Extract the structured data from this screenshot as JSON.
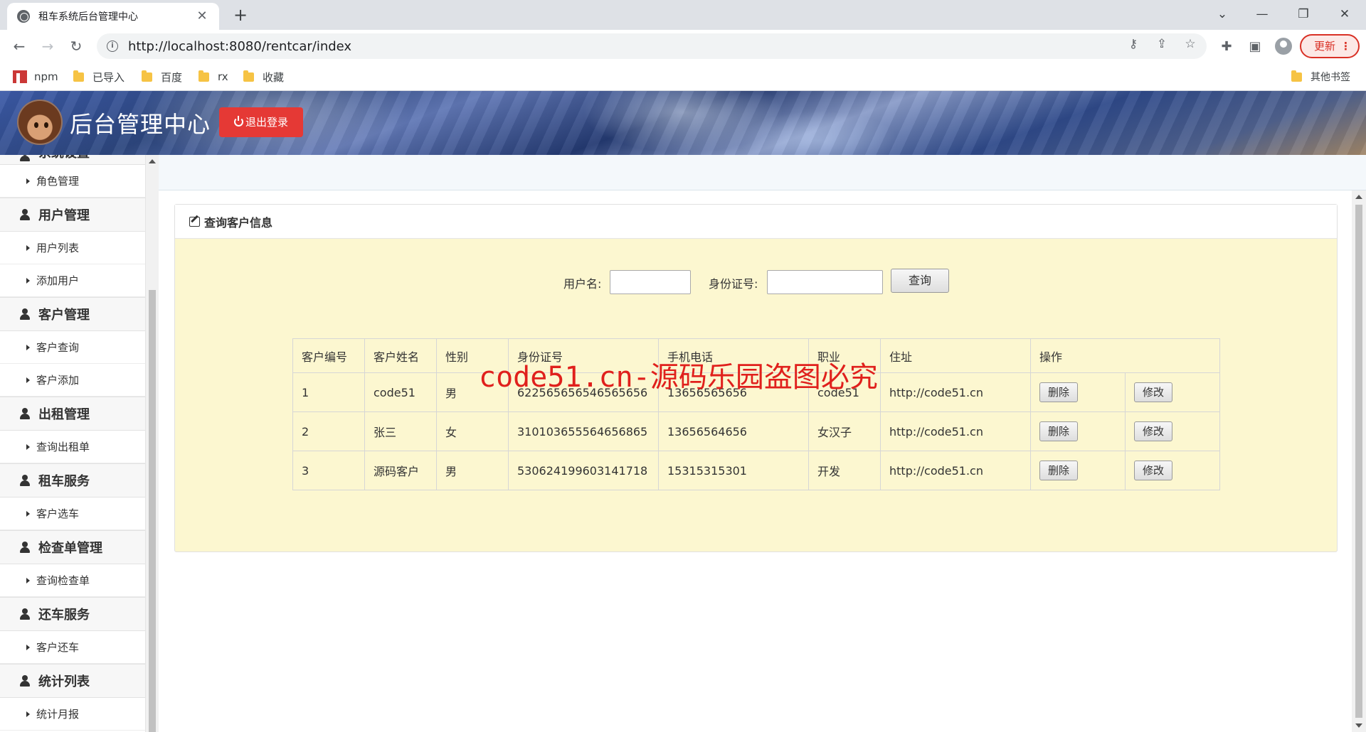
{
  "browser": {
    "tab_title": "租车系统后台管理中心",
    "url": "http://localhost:8080/rentcar/index",
    "update_label": "更新",
    "bookmarks": [
      {
        "label": "npm",
        "icon": "npm-logo-icon"
      },
      {
        "label": "已导入",
        "icon": "folder-icon"
      },
      {
        "label": "百度",
        "icon": "folder-icon"
      },
      {
        "label": "rx",
        "icon": "folder-icon"
      },
      {
        "label": "收藏",
        "icon": "folder-icon"
      }
    ],
    "other_bookmarks": "其他书签"
  },
  "header": {
    "title": "后台管理中心",
    "logout_label": "退出登录",
    "logout_color": "#e53935"
  },
  "sidebar": {
    "partial_group": "系统设置",
    "groups": [
      {
        "label": "系统设置",
        "items": [
          "角色管理"
        ]
      },
      {
        "label": "用户管理",
        "items": [
          "用户列表",
          "添加用户"
        ]
      },
      {
        "label": "客户管理",
        "items": [
          "客户查询",
          "客户添加"
        ]
      },
      {
        "label": "出租管理",
        "items": [
          "查询出租单"
        ]
      },
      {
        "label": "租车服务",
        "items": [
          "客户选车"
        ]
      },
      {
        "label": "检查单管理",
        "items": [
          "查询检查单"
        ]
      },
      {
        "label": "还车服务",
        "items": [
          "客户还车"
        ]
      },
      {
        "label": "统计列表",
        "items": [
          "统计月报"
        ]
      }
    ]
  },
  "panel": {
    "title": "查询客户信息",
    "search": {
      "username_label": "用户名:",
      "username_value": "",
      "idcard_label": "身份证号:",
      "idcard_value": "",
      "query_label": "查询"
    },
    "table": {
      "headers": [
        "客户编号",
        "客户姓名",
        "性别",
        "身份证号",
        "手机电话",
        "职业",
        "住址",
        "操作"
      ],
      "rows": [
        [
          "1",
          "code51",
          "男",
          "622565656546565656",
          "13656565656",
          "code51",
          "http://code51.cn"
        ],
        [
          "2",
          "张三",
          "女",
          "310103655564656865",
          "13656564656",
          "女汉子",
          "http://code51.cn"
        ],
        [
          "3",
          "源码客户",
          "男",
          "530624199603141718",
          "15315315301",
          "开发",
          "http://code51.cn"
        ]
      ],
      "delete_label": "删除",
      "edit_label": "修改"
    },
    "background": "#fcf7d0"
  },
  "watermark": "code51.cn-源码乐园盗图必究"
}
